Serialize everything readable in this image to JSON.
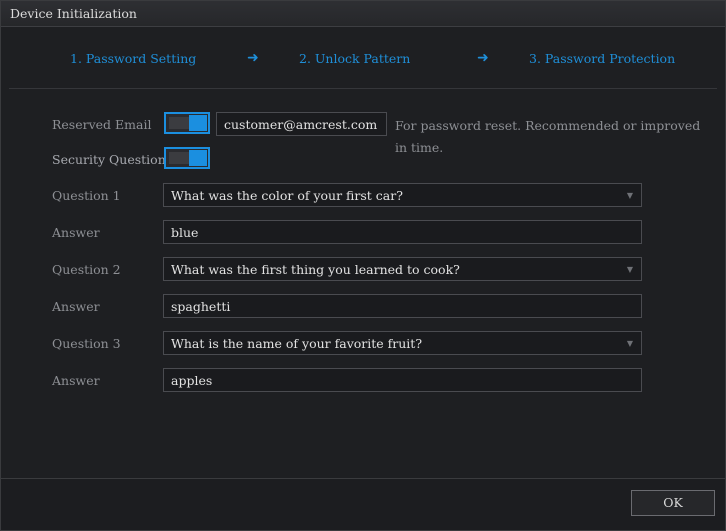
{
  "window": {
    "title": "Device Initialization"
  },
  "steps": [
    {
      "label": "1.  Password Setting"
    },
    {
      "label": "2.  Unlock Pattern"
    },
    {
      "label": "3.  Password Protection"
    }
  ],
  "arrow_symbol": "➜",
  "form": {
    "reserved_email": {
      "label": "Reserved Email",
      "enabled": true,
      "value": "customer@amcrest.com",
      "hint": "For password reset. Recommended or improved in time."
    },
    "security_question": {
      "label": "Security Question",
      "enabled": true
    },
    "q1": {
      "label": "Question 1",
      "value": "What was the color of your first car?"
    },
    "a1": {
      "label": "Answer",
      "value": "blue"
    },
    "q2": {
      "label": "Question 2",
      "value": "What was the first thing you learned to cook?"
    },
    "a2": {
      "label": "Answer",
      "value": "spaghetti"
    },
    "q3": {
      "label": "Question 3",
      "value": "What is the name of your favorite fruit?"
    },
    "a3": {
      "label": "Answer",
      "value": "apples"
    }
  },
  "footer": {
    "ok_label": "OK"
  },
  "colors": {
    "accent": "#1b8fe0",
    "background": "#1e1f22"
  },
  "icons": {
    "dropdown": "chevron-down-icon",
    "toggle": "toggle-switch"
  }
}
